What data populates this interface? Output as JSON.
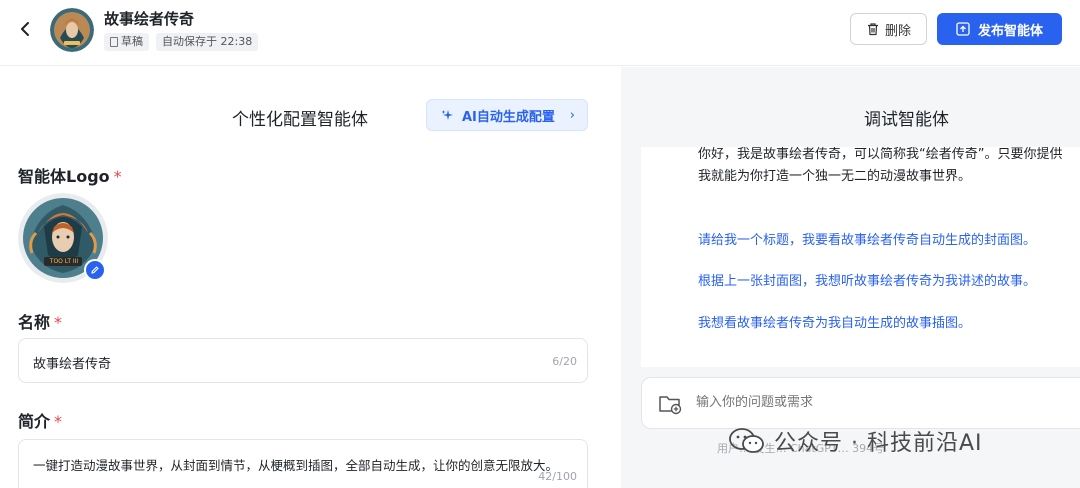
{
  "header": {
    "title": "故事绘者传奇",
    "draft_label": "草稿",
    "autosave_label": "自动保存于 22:38",
    "delete_label": "删除",
    "publish_label": "发布智能体"
  },
  "config": {
    "title": "个性化配置智能体",
    "ai_button_label": "AI自动生成配置",
    "logo_label": "智能体Logo",
    "name_label": "名称",
    "name_value": "故事绘者传奇",
    "name_counter": "6/20",
    "intro_label": "简介",
    "intro_value": "一键打造动漫故事世界，从封面到情节，从梗概到插图，全部自动生成，让你的创意无限放大。",
    "intro_counter": "42/100",
    "required_mark": "*",
    "logo_caption": "TOO LT III"
  },
  "debug": {
    "title": "调试智能体",
    "greeting_line1": "你好，我是故事绘者传奇，可以简称我“绘者传奇”。只要你提供",
    "greeting_line2": "我就能为你打造一个独一无二的动漫故事世界。",
    "suggestions": [
      "请给我一个标题，我要看故事绘者传奇自动生成的封面图。",
      "根据上一张封面图，我想听故事绘者传奇为我讲述的故事。",
      "我想看故事绘者传奇为我自动生成的故事插图。"
    ],
    "input_placeholder": "输入你的问题或需求",
    "footer_note": "用户… 发生… ChatGPT… 394号"
  },
  "watermark": {
    "text": "公众号 · 科技前沿AI"
  },
  "colors": {
    "accent": "#2a62f0",
    "required": "#e5484d",
    "panel_bg": "#f5f6f8"
  }
}
